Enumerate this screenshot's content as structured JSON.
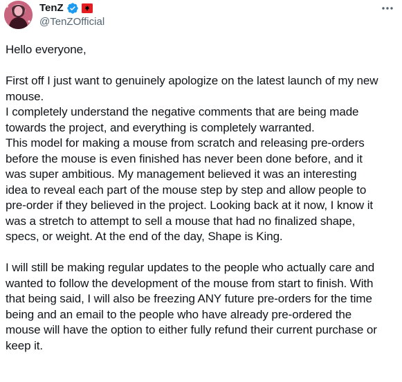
{
  "author": {
    "display_name": "TenZ",
    "handle": "@TenZOfficial",
    "verified_color": "#1d9bf0",
    "flag_color": "#e41e20"
  },
  "icons": {
    "verified": "verified-badge-icon",
    "flag": "albania-flag-icon",
    "more": "more-options-icon"
  },
  "tweet": {
    "greeting": "Hello everyone,",
    "paragraph1": "First off I just want to genuinely apologize on the latest launch of my new\nmouse.\nI completely understand the negative comments that are being made\ntowards the project, and everything is completely warranted.\nThis model for making a mouse from scratch and releasing pre-orders\nbefore the mouse is even finished has never been done before, and it\nwas super ambitious. My management believed it was an interesting\nidea to reveal each part of the mouse step by step and allow people to\npre-order if they believed in the project. Looking back at it now, I know it\nwas a stretch to attempt to sell a mouse that had no finalized shape,\nspecs, or weight. At the end of the day, Shape is King.",
    "paragraph2": "I will still be making regular updates to the people who actually care and\nwanted to follow the development of the mouse from start to finish. With\nthat being said, I will also be freezing ANY future pre-orders for the time\nbeing and an email to the people who have already pre-ordered the\nmouse will have the option to either fully refund their current purchase or\nkeep it."
  }
}
